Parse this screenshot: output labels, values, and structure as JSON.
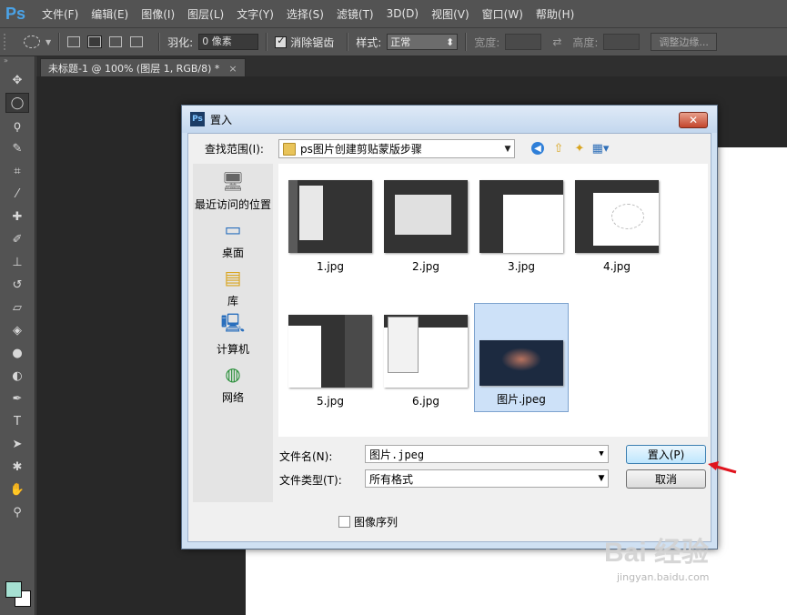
{
  "app": {
    "logo": "Ps"
  },
  "menu": [
    "文件(F)",
    "编辑(E)",
    "图像(I)",
    "图层(L)",
    "文字(Y)",
    "选择(S)",
    "滤镜(T)",
    "3D(D)",
    "视图(V)",
    "窗口(W)",
    "帮助(H)"
  ],
  "options": {
    "feather_label": "羽化:",
    "feather_value": "0 像素",
    "antialias_label": "消除锯齿",
    "style_label": "样式:",
    "style_value": "正常",
    "width_label": "宽度:",
    "height_label": "高度:",
    "refine_label": "调整边缘..."
  },
  "document_tab": {
    "title": "未标题-1 @ 100% (图层 1, RGB/8) *",
    "close": "×"
  },
  "colors": {
    "foreground": "#a6e0d2",
    "background": "#ffffff"
  },
  "dialog": {
    "title": "置入",
    "close": "✕",
    "look_in_label": "查找范围(I):",
    "look_in_value": "ps图片创建剪贴蒙版步骤",
    "places": [
      "最近访问的位置",
      "桌面",
      "库",
      "计算机",
      "网络"
    ],
    "files": [
      "1.jpg",
      "2.jpg",
      "3.jpg",
      "4.jpg",
      "5.jpg",
      "6.jpg",
      "图片.jpeg"
    ],
    "selected_file": "图片.jpeg",
    "filename_label": "文件名(N):",
    "filename_value": "图片.jpeg",
    "filetype_label": "文件类型(T):",
    "filetype_value": "所有格式",
    "place_button": "置入(P)",
    "cancel_button": "取消",
    "sequence_label": "图像序列"
  },
  "watermark": {
    "main": "Bai 经验",
    "sub": "jingyan.baidu.com"
  }
}
